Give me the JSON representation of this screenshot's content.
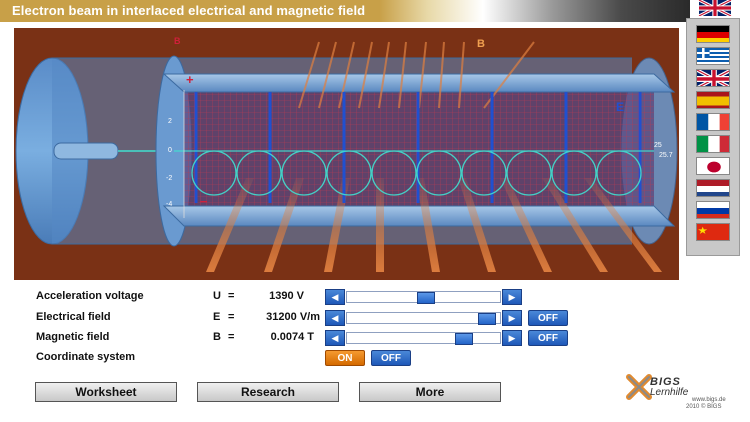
{
  "app": {
    "title": "Electron beam in interlaced electrical and magnetic field"
  },
  "scene": {
    "label_b_left": "B",
    "label_b_right": "B",
    "label_e": "E",
    "label_plus": "+",
    "label_minus": "−",
    "axis_ticks": [
      "2",
      "0",
      "-2",
      "-4"
    ],
    "readout_top": "25",
    "readout_bottom": "25.7"
  },
  "languages": [
    {
      "name": "english-flag-top",
      "code": "en"
    },
    {
      "name": "german-flag",
      "code": "de"
    },
    {
      "name": "greek-flag",
      "code": "el"
    },
    {
      "name": "english-flag",
      "code": "en"
    },
    {
      "name": "spanish-flag",
      "code": "es"
    },
    {
      "name": "french-flag",
      "code": "fr"
    },
    {
      "name": "italian-flag",
      "code": "it"
    },
    {
      "name": "japanese-flag",
      "code": "ja"
    },
    {
      "name": "dutch-flag",
      "code": "nl"
    },
    {
      "name": "russian-flag",
      "code": "ru"
    },
    {
      "name": "chinese-flag",
      "code": "zh"
    }
  ],
  "controls": {
    "acceleration": {
      "label": "Acceleration voltage",
      "symbol": "U",
      "eq": "=",
      "value": "1390 V",
      "level": 0.52
    },
    "electrical": {
      "label": "Electrical field",
      "symbol": "E",
      "eq": "=",
      "value": "31200 V/m",
      "level": 0.97,
      "toggle": "OFF"
    },
    "magnetic": {
      "label": "Magnetic field",
      "symbol": "B",
      "eq": "=",
      "value": "0.0074 T",
      "level": 0.8,
      "toggle": "OFF"
    },
    "coordinate": {
      "label": "Coordinate system",
      "on": "ON",
      "off": "OFF"
    }
  },
  "buttons": {
    "worksheet": "Worksheet",
    "research": "Research",
    "more": "More"
  },
  "logo": {
    "brand": "BIGS",
    "sub": "Lernhilfe",
    "url": "www.bigs.de",
    "copyright": "2010 © BIGS"
  },
  "colors": {
    "title_gold": "#c8a048",
    "scene_bg": "#7a3115",
    "accent_blue": "#1e58b8",
    "accent_orange": "#d46a00"
  }
}
